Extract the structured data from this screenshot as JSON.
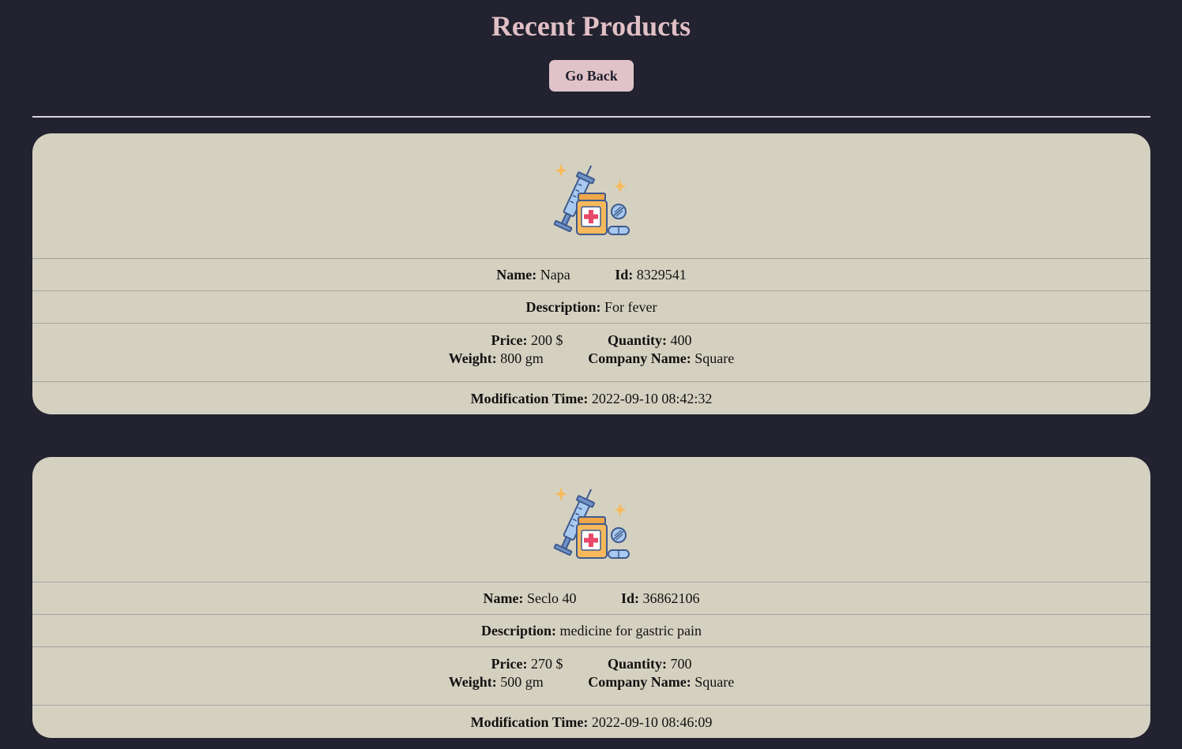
{
  "page": {
    "title": "Recent Products",
    "go_back_label": "Go Back"
  },
  "labels": {
    "name": "Name:",
    "id": "Id:",
    "description": "Description:",
    "price": "Price:",
    "quantity": "Quantity:",
    "weight": "Weight:",
    "company": "Company Name:",
    "modification": "Modification Time:"
  },
  "products": [
    {
      "name": "Napa",
      "id": "8329541",
      "description": "For fever",
      "price": "200 $",
      "quantity": "400",
      "weight": "800 gm",
      "company": "Square",
      "modification_time": "2022-09-10 08:42:32",
      "icon": "medicine-icon"
    },
    {
      "name": "Seclo 40",
      "id": "36862106",
      "description": "medicine for gastric pain",
      "price": "270 $",
      "quantity": "700",
      "weight": "500 gm",
      "company": "Square",
      "modification_time": "2022-09-10 08:46:09",
      "icon": "medicine-icon"
    }
  ],
  "colors": {
    "background": "#222230",
    "title": "#e0bfc5",
    "button": "#e0c3c8",
    "card": "#d5d1c1"
  }
}
